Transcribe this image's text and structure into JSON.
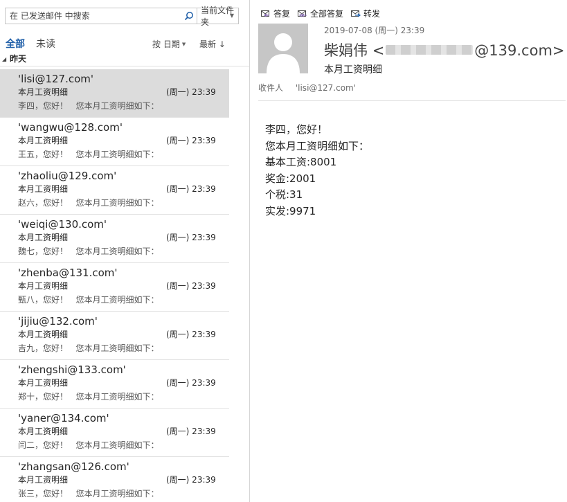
{
  "search": {
    "placeholder": "在 已发送邮件 中搜索",
    "scope": "当前文件夹"
  },
  "filters": {
    "all": "全部",
    "unread": "未读",
    "sort_by": "按 日期",
    "sort_order": "最新 ↓"
  },
  "group": {
    "label": "昨天"
  },
  "mails": [
    {
      "sender": "'lisi@127.com'",
      "subject": "本月工资明细",
      "time": "(周一) 23:39",
      "preview": "李四，您好！   您本月工资明细如下：",
      "selected": true
    },
    {
      "sender": "'wangwu@128.com'",
      "subject": "本月工资明细",
      "time": "(周一) 23:39",
      "preview": "王五，您好！   您本月工资明细如下：",
      "selected": false
    },
    {
      "sender": "'zhaoliu@129.com'",
      "subject": "本月工资明细",
      "time": "(周一) 23:39",
      "preview": "赵六，您好！   您本月工资明细如下：",
      "selected": false
    },
    {
      "sender": "'weiqi@130.com'",
      "subject": "本月工资明细",
      "time": "(周一) 23:39",
      "preview": "魏七，您好！   您本月工资明细如下：",
      "selected": false
    },
    {
      "sender": "'zhenba@131.com'",
      "subject": "本月工资明细",
      "time": "(周一) 23:39",
      "preview": "甄八，您好！   您本月工资明细如下：",
      "selected": false
    },
    {
      "sender": "'jijiu@132.com'",
      "subject": "本月工资明细",
      "time": "(周一) 23:39",
      "preview": "吉九，您好！   您本月工资明细如下：",
      "selected": false
    },
    {
      "sender": "'zhengshi@133.com'",
      "subject": "本月工资明细",
      "time": "(周一) 23:39",
      "preview": "郑十，您好！   您本月工资明细如下：",
      "selected": false
    },
    {
      "sender": "'yaner@134.com'",
      "subject": "本月工资明细",
      "time": "(周一) 23:39",
      "preview": "闫二，您好！   您本月工资明细如下：",
      "selected": false
    },
    {
      "sender": "'zhangsan@126.com'",
      "subject": "本月工资明细",
      "time": "(周一) 23:39",
      "preview": "张三，您好！   您本月工资明细如下：",
      "selected": false
    }
  ],
  "reading": {
    "actions": {
      "reply": "答复",
      "reply_all": "全部答复",
      "forward": "转发"
    },
    "date": "2019-07-08 (周一) 23:39",
    "from_name": "柴娟伟",
    "from_email_prefix": "<",
    "from_email_suffix": "@139.com>",
    "subject": "本月工资明细",
    "to_label": "收件人",
    "to_value": "'lisi@127.com'",
    "body": [
      "李四，您好！",
      "您本月工资明细如下：",
      "基本工资:8001",
      "奖金:2001",
      "个税:31",
      "实发:9971"
    ]
  },
  "colors": {
    "accent": "#1e5ea8",
    "selected_row": "#dcdcdc",
    "avatar_bg": "#c6c6c6"
  }
}
